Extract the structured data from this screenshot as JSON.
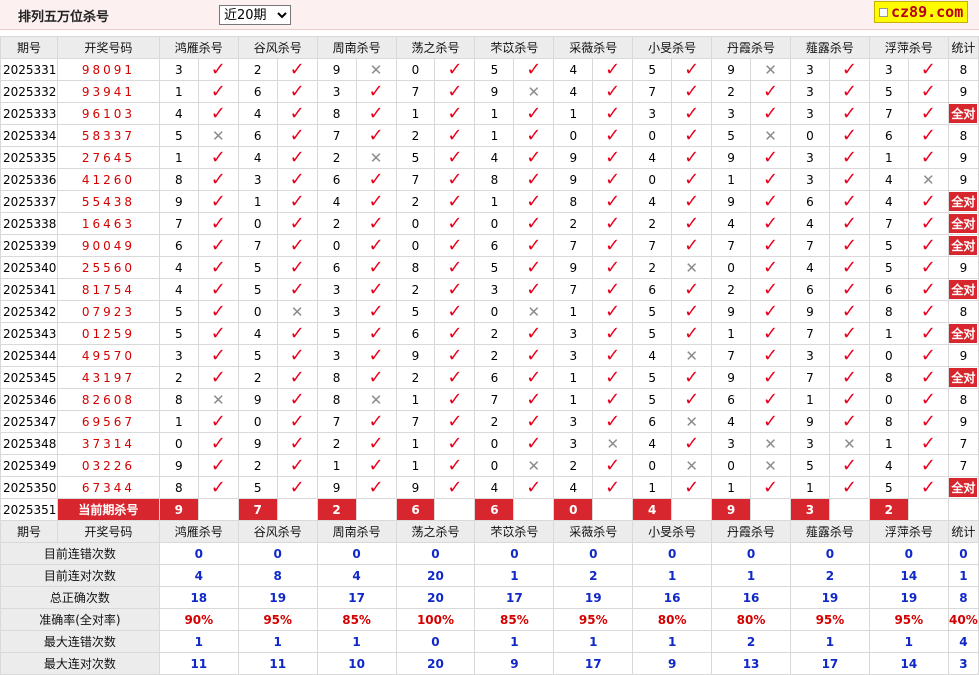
{
  "header": {
    "title": "排列五万位杀号",
    "range_selected": "近20期"
  },
  "logo": {
    "text": "cz89.com"
  },
  "columns": {
    "period": "期号",
    "draw": "开奖号码",
    "total": "统计",
    "experts": [
      "鸿雁杀号",
      "谷风杀号",
      "周南杀号",
      "荡之杀号",
      "芣苡杀号",
      "采薇杀号",
      "小旻杀号",
      "丹霞杀号",
      "薤露杀号",
      "浮萍杀号"
    ]
  },
  "rows": [
    {
      "period": "2025331",
      "draw": "98091",
      "picks": [
        "3",
        "2",
        "9",
        "0",
        "5",
        "4",
        "5",
        "9",
        "3",
        "3"
      ],
      "marks": [
        1,
        1,
        0,
        1,
        1,
        1,
        1,
        0,
        1,
        1
      ],
      "total": "8"
    },
    {
      "period": "2025332",
      "draw": "93941",
      "picks": [
        "1",
        "6",
        "3",
        "7",
        "9",
        "4",
        "7",
        "2",
        "3",
        "5"
      ],
      "marks": [
        1,
        1,
        1,
        1,
        0,
        1,
        1,
        1,
        1,
        1
      ],
      "total": "9"
    },
    {
      "period": "2025333",
      "draw": "96103",
      "picks": [
        "4",
        "4",
        "8",
        "1",
        "1",
        "1",
        "3",
        "3",
        "3",
        "7"
      ],
      "marks": [
        1,
        1,
        1,
        1,
        1,
        1,
        1,
        1,
        1,
        1
      ],
      "total": "全对"
    },
    {
      "period": "2025334",
      "draw": "58337",
      "picks": [
        "5",
        "6",
        "7",
        "2",
        "1",
        "0",
        "0",
        "5",
        "0",
        "6"
      ],
      "marks": [
        0,
        1,
        1,
        1,
        1,
        1,
        1,
        0,
        1,
        1
      ],
      "total": "8"
    },
    {
      "period": "2025335",
      "draw": "27645",
      "picks": [
        "1",
        "4",
        "2",
        "5",
        "4",
        "9",
        "4",
        "9",
        "3",
        "1"
      ],
      "marks": [
        1,
        1,
        0,
        1,
        1,
        1,
        1,
        1,
        1,
        1
      ],
      "total": "9"
    },
    {
      "period": "2025336",
      "draw": "41260",
      "picks": [
        "8",
        "3",
        "6",
        "7",
        "8",
        "9",
        "0",
        "1",
        "3",
        "4"
      ],
      "marks": [
        1,
        1,
        1,
        1,
        1,
        1,
        1,
        1,
        1,
        0
      ],
      "total": "9"
    },
    {
      "period": "2025337",
      "draw": "55438",
      "picks": [
        "9",
        "1",
        "4",
        "2",
        "1",
        "8",
        "4",
        "9",
        "6",
        "4"
      ],
      "marks": [
        1,
        1,
        1,
        1,
        1,
        1,
        1,
        1,
        1,
        1
      ],
      "total": "全对"
    },
    {
      "period": "2025338",
      "draw": "16463",
      "picks": [
        "7",
        "0",
        "2",
        "0",
        "0",
        "2",
        "2",
        "4",
        "4",
        "7"
      ],
      "marks": [
        1,
        1,
        1,
        1,
        1,
        1,
        1,
        1,
        1,
        1
      ],
      "total": "全对"
    },
    {
      "period": "2025339",
      "draw": "90049",
      "picks": [
        "6",
        "7",
        "0",
        "0",
        "6",
        "7",
        "7",
        "7",
        "7",
        "5"
      ],
      "marks": [
        1,
        1,
        1,
        1,
        1,
        1,
        1,
        1,
        1,
        1
      ],
      "total": "全对"
    },
    {
      "period": "2025340",
      "draw": "25560",
      "picks": [
        "4",
        "5",
        "6",
        "8",
        "5",
        "9",
        "2",
        "0",
        "4",
        "5"
      ],
      "marks": [
        1,
        1,
        1,
        1,
        1,
        1,
        0,
        1,
        1,
        1
      ],
      "total": "9"
    },
    {
      "period": "2025341",
      "draw": "81754",
      "picks": [
        "4",
        "5",
        "3",
        "2",
        "3",
        "7",
        "6",
        "2",
        "6",
        "6"
      ],
      "marks": [
        1,
        1,
        1,
        1,
        1,
        1,
        1,
        1,
        1,
        1
      ],
      "total": "全对"
    },
    {
      "period": "2025342",
      "draw": "07923",
      "picks": [
        "5",
        "0",
        "3",
        "5",
        "0",
        "1",
        "5",
        "9",
        "9",
        "8"
      ],
      "marks": [
        1,
        0,
        1,
        1,
        0,
        1,
        1,
        1,
        1,
        1
      ],
      "total": "8"
    },
    {
      "period": "2025343",
      "draw": "01259",
      "picks": [
        "5",
        "4",
        "5",
        "6",
        "2",
        "3",
        "5",
        "1",
        "7",
        "1"
      ],
      "marks": [
        1,
        1,
        1,
        1,
        1,
        1,
        1,
        1,
        1,
        1
      ],
      "total": "全对"
    },
    {
      "period": "2025344",
      "draw": "49570",
      "picks": [
        "3",
        "5",
        "3",
        "9",
        "2",
        "3",
        "4",
        "7",
        "3",
        "0"
      ],
      "marks": [
        1,
        1,
        1,
        1,
        1,
        1,
        0,
        1,
        1,
        1
      ],
      "total": "9"
    },
    {
      "period": "2025345",
      "draw": "43197",
      "picks": [
        "2",
        "2",
        "8",
        "2",
        "6",
        "1",
        "5",
        "9",
        "7",
        "8"
      ],
      "marks": [
        1,
        1,
        1,
        1,
        1,
        1,
        1,
        1,
        1,
        1
      ],
      "total": "全对"
    },
    {
      "period": "2025346",
      "draw": "82608",
      "picks": [
        "8",
        "9",
        "8",
        "1",
        "7",
        "1",
        "5",
        "6",
        "1",
        "0"
      ],
      "marks": [
        0,
        1,
        0,
        1,
        1,
        1,
        1,
        1,
        1,
        1
      ],
      "total": "8"
    },
    {
      "period": "2025347",
      "draw": "69567",
      "picks": [
        "1",
        "0",
        "7",
        "7",
        "2",
        "3",
        "6",
        "4",
        "9",
        "8"
      ],
      "marks": [
        1,
        1,
        1,
        1,
        1,
        1,
        0,
        1,
        1,
        1
      ],
      "total": "9"
    },
    {
      "period": "2025348",
      "draw": "37314",
      "picks": [
        "0",
        "9",
        "2",
        "1",
        "0",
        "3",
        "4",
        "3",
        "3",
        "1"
      ],
      "marks": [
        1,
        1,
        1,
        1,
        1,
        0,
        1,
        0,
        0,
        1
      ],
      "total": "7"
    },
    {
      "period": "2025349",
      "draw": "03226",
      "picks": [
        "9",
        "2",
        "1",
        "1",
        "0",
        "2",
        "0",
        "0",
        "5",
        "4"
      ],
      "marks": [
        1,
        1,
        1,
        1,
        0,
        1,
        0,
        0,
        1,
        1
      ],
      "total": "7"
    },
    {
      "period": "2025350",
      "draw": "67344",
      "picks": [
        "8",
        "5",
        "9",
        "9",
        "4",
        "4",
        "1",
        "1",
        "1",
        "5"
      ],
      "marks": [
        1,
        1,
        1,
        1,
        1,
        1,
        1,
        1,
        1,
        1
      ],
      "total": "全对"
    }
  ],
  "current": {
    "period": "2025351",
    "label": "当前期杀号",
    "picks": [
      "9",
      "7",
      "2",
      "6",
      "6",
      "0",
      "4",
      "9",
      "3",
      "2"
    ]
  },
  "stats": [
    {
      "label": "目前连错次数",
      "values": [
        "0",
        "0",
        "0",
        "0",
        "0",
        "0",
        "0",
        "0",
        "0",
        "0"
      ],
      "total": "0",
      "style": "blue"
    },
    {
      "label": "目前连对次数",
      "values": [
        "4",
        "8",
        "4",
        "20",
        "1",
        "2",
        "1",
        "1",
        "2",
        "14"
      ],
      "total": "1",
      "style": "blue"
    },
    {
      "label": "总正确次数",
      "values": [
        "18",
        "19",
        "17",
        "20",
        "17",
        "19",
        "16",
        "16",
        "19",
        "19"
      ],
      "total": "8",
      "style": "blue"
    },
    {
      "label": "准确率(全对率)",
      "values": [
        "90%",
        "95%",
        "85%",
        "100%",
        "85%",
        "95%",
        "80%",
        "80%",
        "95%",
        "95%"
      ],
      "total": "40%",
      "style": "red"
    },
    {
      "label": "最大连错次数",
      "values": [
        "1",
        "1",
        "1",
        "0",
        "1",
        "1",
        "1",
        "2",
        "1",
        "1"
      ],
      "total": "4",
      "style": "blue"
    },
    {
      "label": "最大连对次数",
      "values": [
        "11",
        "11",
        "10",
        "20",
        "9",
        "17",
        "9",
        "13",
        "17",
        "14"
      ],
      "total": "3",
      "style": "blue"
    }
  ],
  "symbols": {
    "tick": "✓",
    "cross": "✕",
    "tick_color": "#e8001d",
    "accent_red": "#d8262e",
    "stat_blue": "#1028c8"
  }
}
